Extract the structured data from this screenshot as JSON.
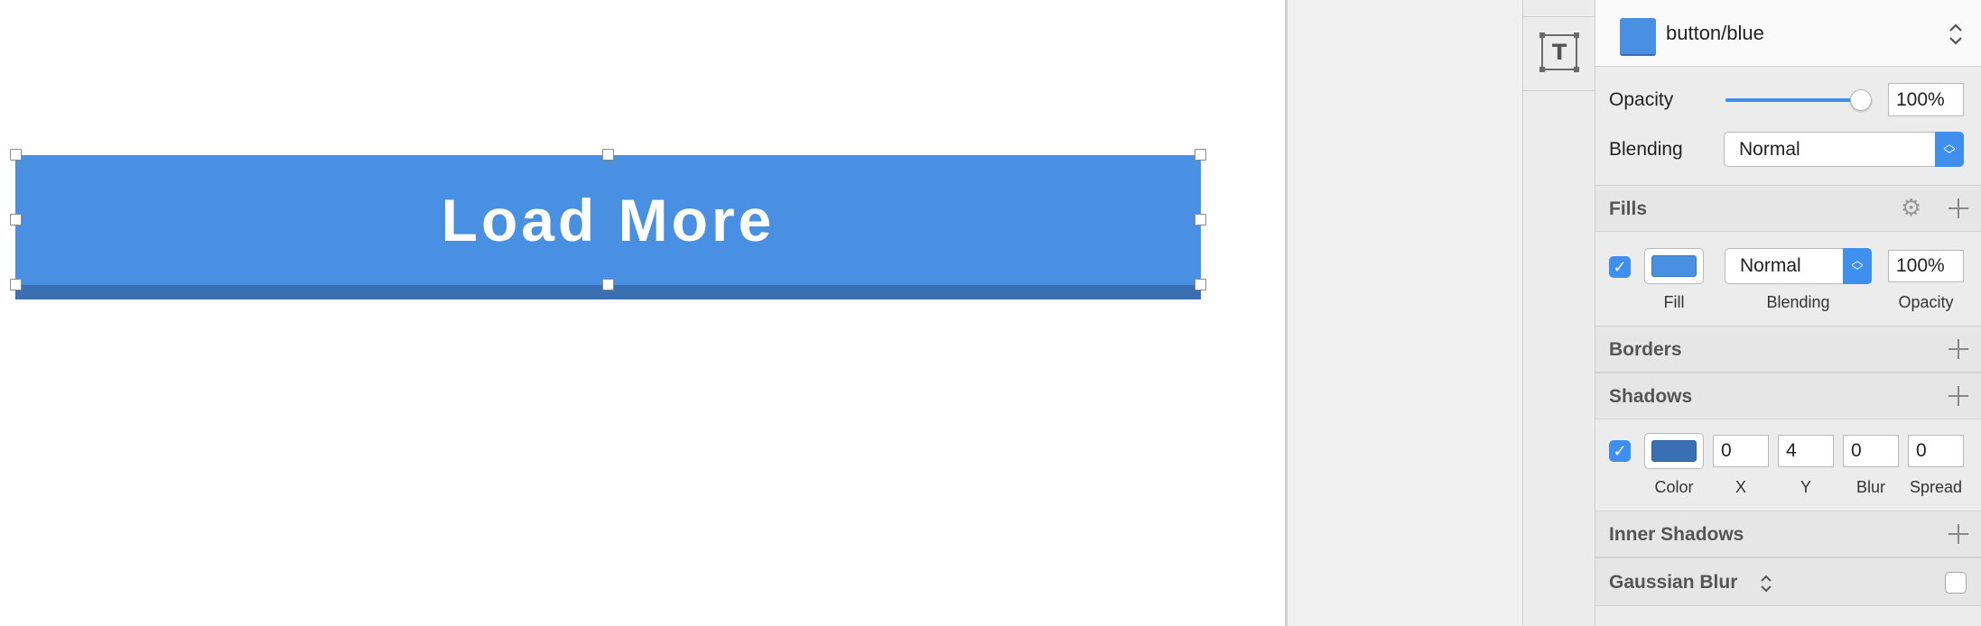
{
  "canvas": {
    "button_label": "Load More",
    "button_color": "#4a90e2",
    "button_shadow_color": "#3b6fb4"
  },
  "toolbar": {
    "text_tool_glyph": "T",
    "text_tool_icon": "text-tool-icon"
  },
  "inspector": {
    "style": {
      "name": "button/blue",
      "swatch_color": "#4a90e2",
      "chevron": "⌃⌄"
    },
    "opacity": {
      "label": "Opacity",
      "value": "100%",
      "level": 1.0
    },
    "blending": {
      "label": "Blending",
      "value": "Normal"
    },
    "fills": {
      "title": "Fills",
      "enabled": true,
      "color": "#4a90e2",
      "blending_value": "Normal",
      "opacity_value": "100%",
      "captions": {
        "fill": "Fill",
        "blending": "Blending",
        "opacity": "Opacity"
      }
    },
    "borders": {
      "title": "Borders"
    },
    "shadows": {
      "title": "Shadows",
      "enabled": true,
      "color": "#3b6fb4",
      "x": "0",
      "y": "4",
      "blur": "0",
      "spread": "0",
      "captions": {
        "color": "Color",
        "x": "X",
        "y": "Y",
        "blur": "Blur",
        "spread": "Spread"
      }
    },
    "inner_shadows": {
      "title": "Inner Shadows"
    },
    "gaussian_blur": {
      "title": "Gaussian Blur",
      "enabled": false
    }
  }
}
